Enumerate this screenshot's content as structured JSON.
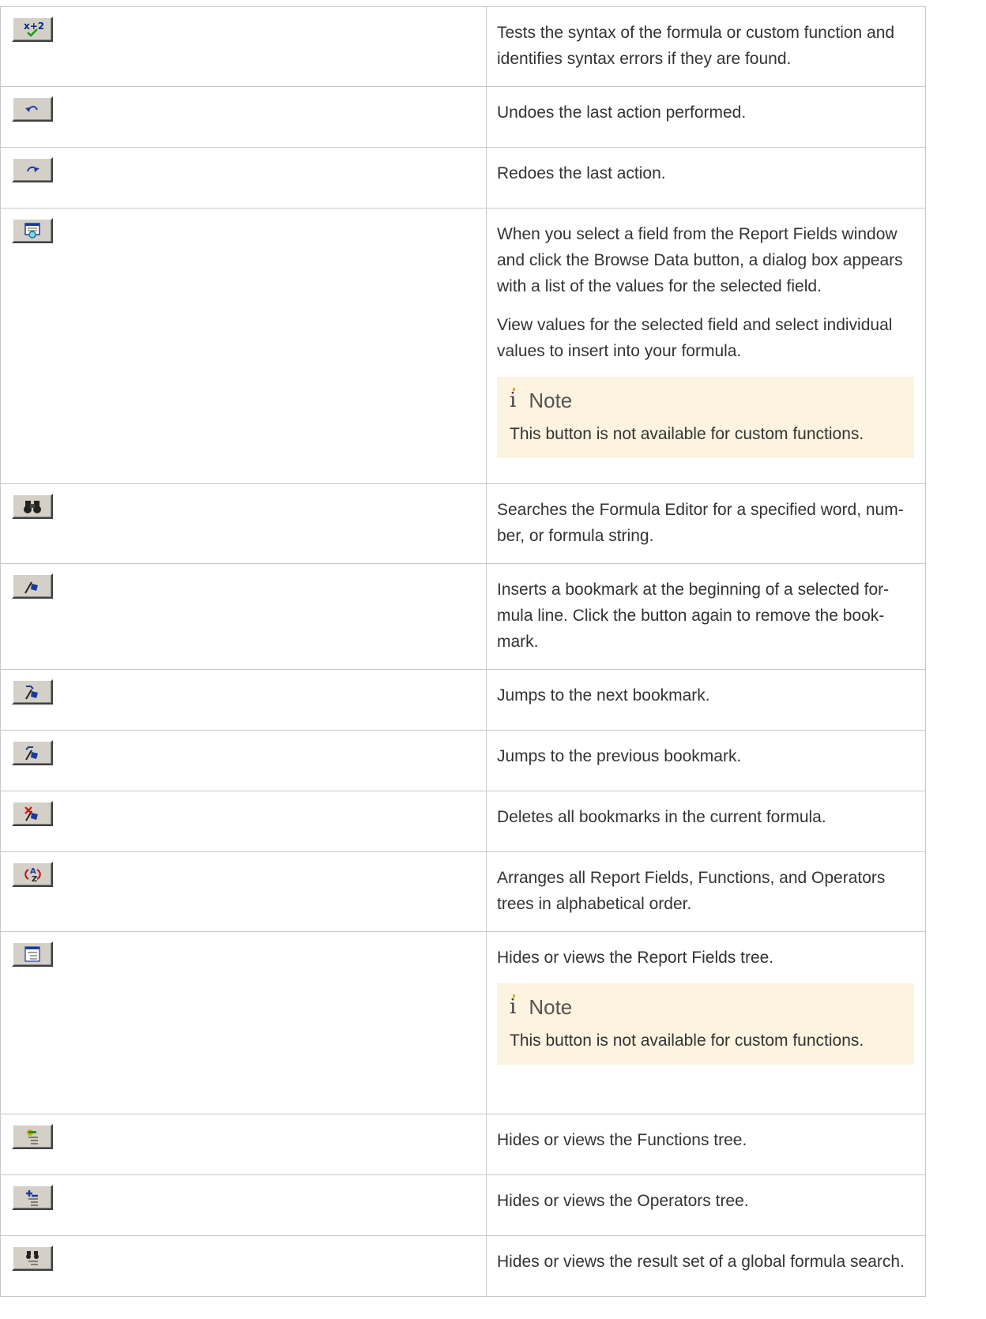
{
  "rows": [
    {
      "icon": "check-syntax-icon",
      "paragraphs": [
        "Tests the syntax of the formula or custom function and identifies syntax errors if they are found."
      ]
    },
    {
      "icon": "undo-icon",
      "paragraphs": [
        "Undoes the last action performed."
      ]
    },
    {
      "icon": "redo-icon",
      "paragraphs": [
        "Redoes the last action."
      ]
    },
    {
      "icon": "browse-data-icon",
      "paragraphs": [
        "When you select a field from the Report Fields window and click the Browse Data button, a dialog box appears with a list of the values for the selected field.",
        "View values for the selected field and select individual values to insert into your formula."
      ],
      "note": {
        "title": "Note",
        "text": "This button is not available for custom functions."
      }
    },
    {
      "icon": "binoculars-find-icon",
      "paragraphs": [
        "Searches the Formula Editor for a specified word, num-ber, or formula string."
      ]
    },
    {
      "icon": "toggle-bookmark-icon",
      "paragraphs": [
        "Inserts a bookmark at the beginning of a selected for-mula line. Click the button again to remove the book-mark."
      ]
    },
    {
      "icon": "next-bookmark-icon",
      "paragraphs": [
        "Jumps to the next bookmark."
      ]
    },
    {
      "icon": "previous-bookmark-icon",
      "paragraphs": [
        "Jumps to the previous bookmark."
      ]
    },
    {
      "icon": "clear-bookmarks-icon",
      "paragraphs": [
        "Deletes all bookmarks in the current formula."
      ]
    },
    {
      "icon": "sort-az-icon",
      "paragraphs": [
        "Arranges all Report Fields, Functions, and Operators trees in alphabetical order."
      ]
    },
    {
      "icon": "report-fields-tree-icon",
      "paragraphs": [
        "Hides or views the Report Fields tree."
      ],
      "note": {
        "title": "Note",
        "text": "This button is not available for custom functions."
      }
    },
    {
      "icon": "functions-tree-icon",
      "paragraphs": [
        "Hides or views the Functions tree."
      ]
    },
    {
      "icon": "operators-tree-icon",
      "paragraphs": [
        "Hides or views the Operators tree."
      ]
    },
    {
      "icon": "search-results-tree-icon",
      "paragraphs": [
        "Hides or views the result set of a global formula search."
      ]
    }
  ]
}
